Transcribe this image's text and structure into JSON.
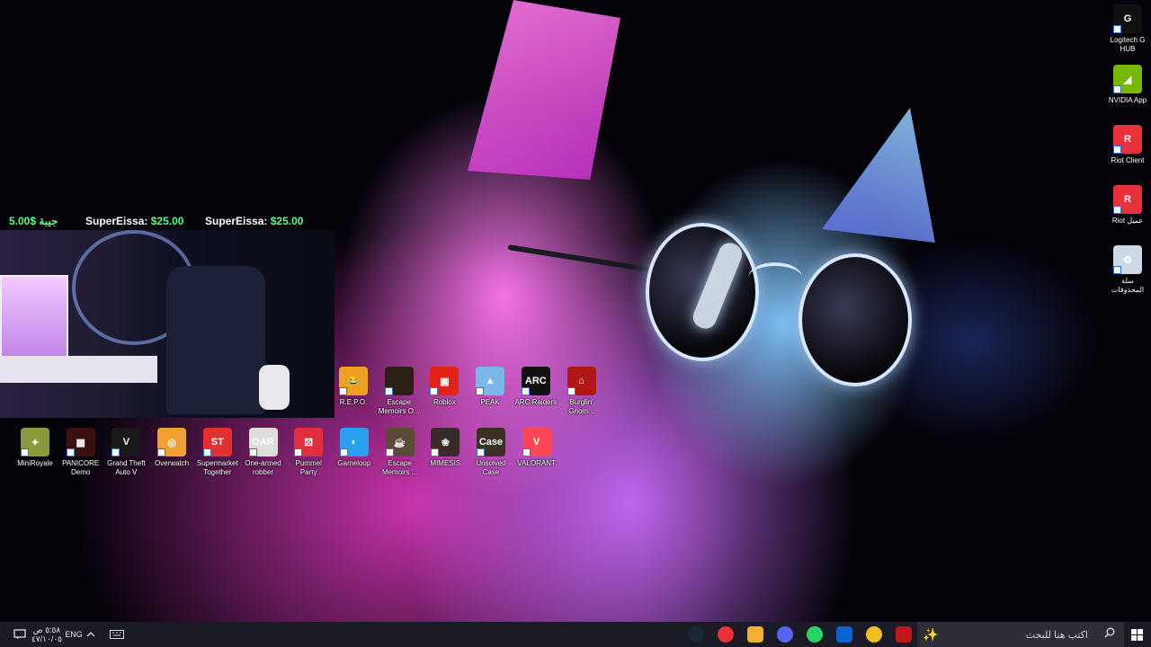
{
  "desktop": {
    "right_icons": [
      {
        "name": "logitech",
        "label": "Logitech G HUB",
        "color": "#111111",
        "glyph": "G"
      },
      {
        "name": "nvidia",
        "label": "NVIDIA App",
        "color": "#76b900",
        "glyph": "◢"
      },
      {
        "name": "riot-client",
        "label": "Riot Client",
        "color": "#e8313a",
        "glyph": "R"
      },
      {
        "name": "riot-ar",
        "label": "Riot عميل",
        "color": "#e8313a",
        "glyph": "R"
      },
      {
        "name": "recycle-bin",
        "label": "سلة المحذوفات",
        "color": "#cfd8e6",
        "glyph": "♻"
      }
    ],
    "row1": [
      {
        "name": "repo",
        "label": "R.E.P.O.",
        "color": "#f0a020",
        "glyph": "😂"
      },
      {
        "name": "escape-memoirs-1",
        "label": "Escape Memoirs O...",
        "color": "#2a2018",
        "glyph": ""
      },
      {
        "name": "roblox",
        "label": "Roblox",
        "color": "#e2231a",
        "glyph": "▣"
      },
      {
        "name": "peak",
        "label": "PEAK",
        "color": "#7ab6e8",
        "glyph": "▲"
      },
      {
        "name": "arc-raiders",
        "label": "ARC Raiders",
        "color": "#111111",
        "glyph": "ARC"
      },
      {
        "name": "burglin-gnomes",
        "label": "Burglin' Gnom...",
        "color": "#b01818",
        "glyph": "⌂"
      }
    ],
    "row2": [
      {
        "name": "miniroyale",
        "label": "MiniRoyale",
        "color": "#8a9a3a",
        "glyph": "✦"
      },
      {
        "name": "panicore",
        "label": "PANICORE Demo",
        "color": "#3a1010",
        "glyph": "▦"
      },
      {
        "name": "gta5",
        "label": "Grand Theft Auto V",
        "color": "#1a1a1a",
        "glyph": "V"
      },
      {
        "name": "overwatch",
        "label": "Overwatch",
        "color": "#f0a030",
        "glyph": "◎"
      },
      {
        "name": "supermarket-together",
        "label": "Supermarket Together",
        "color": "#e03030",
        "glyph": "ST"
      },
      {
        "name": "one-armed-robber",
        "label": "One-armed robber",
        "color": "#dddddd",
        "glyph": "OAR"
      },
      {
        "name": "pummel-party",
        "label": "Pummel Party",
        "color": "#e03040",
        "glyph": "⚄"
      },
      {
        "name": "gameloop",
        "label": "Gameloop",
        "color": "#2aa0f0",
        "glyph": "◐"
      },
      {
        "name": "escape-memoirs-2",
        "label": "Escape Memoirs ...",
        "color": "#5a4a38",
        "glyph": "☕"
      },
      {
        "name": "mimesis",
        "label": "MIMESIS",
        "color": "#3a2a2a",
        "glyph": "❀"
      },
      {
        "name": "unsolved-case",
        "label": "Unsolved Case",
        "color": "#3a3024",
        "glyph": "Case"
      },
      {
        "name": "valorant",
        "label": "VALORANT",
        "color": "#ff4655",
        "glyph": "V"
      }
    ]
  },
  "stream_overlay": {
    "donation1_name": "جيبة",
    "donation1_amount": "5.00$",
    "donation2_name": "SuperEissa:",
    "donation2_amount": "$25.00",
    "donation3_name": "SuperEissa:",
    "donation3_amount": "$25.00"
  },
  "taskbar": {
    "search_placeholder": "اكتب هنا للبحث",
    "language": "ENG",
    "time": "٥:٥٨ ص",
    "date": "٤٧/١٠/٠٥",
    "apps": [
      {
        "name": "steam",
        "color": "#1b2838"
      },
      {
        "name": "riot",
        "color": "#e8313a"
      },
      {
        "name": "discord-yellow",
        "color": "#f0b030"
      },
      {
        "name": "discord",
        "color": "#5865f2"
      },
      {
        "name": "whatsapp",
        "color": "#25d366"
      },
      {
        "name": "outlook",
        "color": "#0a64d0"
      },
      {
        "name": "chrome",
        "color": "#f0c020"
      },
      {
        "name": "voice-meeter",
        "color": "#c01818"
      }
    ]
  }
}
